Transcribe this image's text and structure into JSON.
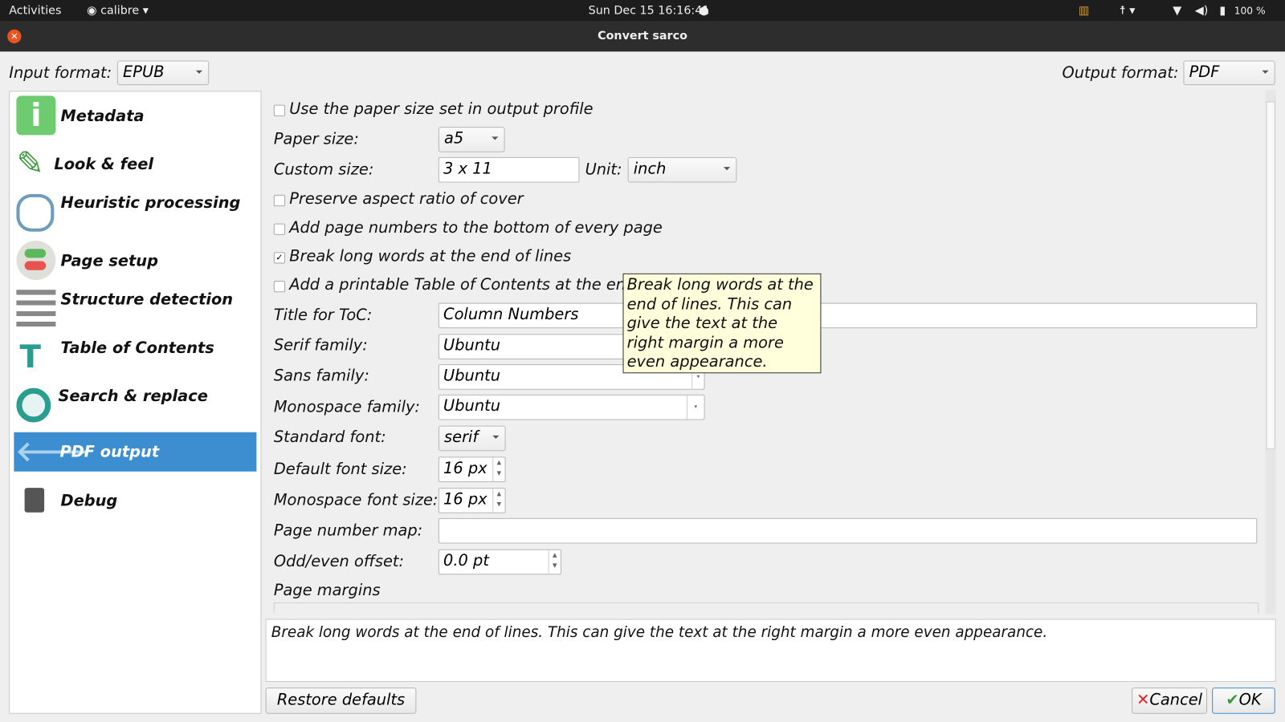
{
  "topbar": {
    "activities": "Activities",
    "app": "calibre",
    "clock": "Sun Dec 15  16:16:41",
    "battery": "100 %"
  },
  "window": {
    "title": "Convert sarco"
  },
  "formats": {
    "input_label": "Input format:",
    "input_value": "EPUB",
    "output_label": "Output format:",
    "output_value": "PDF"
  },
  "sidebar": {
    "items": [
      {
        "label": "Metadata"
      },
      {
        "label": "Look & feel"
      },
      {
        "label": "Heuristic processing"
      },
      {
        "label": "Page setup"
      },
      {
        "label": "Structure detection"
      },
      {
        "label": "Table of Contents"
      },
      {
        "label": "Search & replace"
      },
      {
        "label": "PDF output"
      },
      {
        "label": "Debug"
      }
    ],
    "selected": "PDF output"
  },
  "form": {
    "use_paper_size": {
      "label": "Use the paper size set in output profile",
      "checked": false
    },
    "paper_size": {
      "label": "Paper size:",
      "value": "a5"
    },
    "custom_size": {
      "label": "Custom size:",
      "value": "3 x 11",
      "unit_label": "Unit:",
      "unit_value": "inch"
    },
    "preserve_aspect": {
      "label": "Preserve aspect ratio of cover",
      "checked": false
    },
    "page_numbers": {
      "label": "Add page numbers to the bottom of every page",
      "checked": false
    },
    "break_words": {
      "label": "Break long words at the end of lines",
      "checked": true,
      "mark": "✓"
    },
    "printable_toc": {
      "label": "Add a printable Table of Contents at the end",
      "checked": false
    },
    "toc_title": {
      "label": "Title for ToC:",
      "value": "Column Numbers"
    },
    "serif_family": {
      "label": "Serif family:",
      "value": "Ubuntu"
    },
    "sans_family": {
      "label": "Sans family:",
      "value": "Ubuntu"
    },
    "mono_family": {
      "label": "Monospace family:",
      "value": "Ubuntu"
    },
    "standard_font": {
      "label": "Standard font:",
      "value": "serif"
    },
    "default_font_size": {
      "label": "Default font size:",
      "value": "16 px"
    },
    "mono_font_size": {
      "label": "Monospace font size:",
      "value": "16 px"
    },
    "page_number_map": {
      "label": "Page number map:",
      "value": ""
    },
    "odd_even_offset": {
      "label": "Odd/even offset:",
      "value": "0.0 pt"
    },
    "page_margins": {
      "label": "Page  margins"
    }
  },
  "tooltip": "Break long words at the end of lines. This can give the text at the right margin a more even appearance.",
  "help_text": "Break long words at the end of lines. This can give the text at the right margin a more even appearance.",
  "buttons": {
    "restore": "Restore defaults",
    "cancel": "Cancel",
    "ok": "OK"
  }
}
